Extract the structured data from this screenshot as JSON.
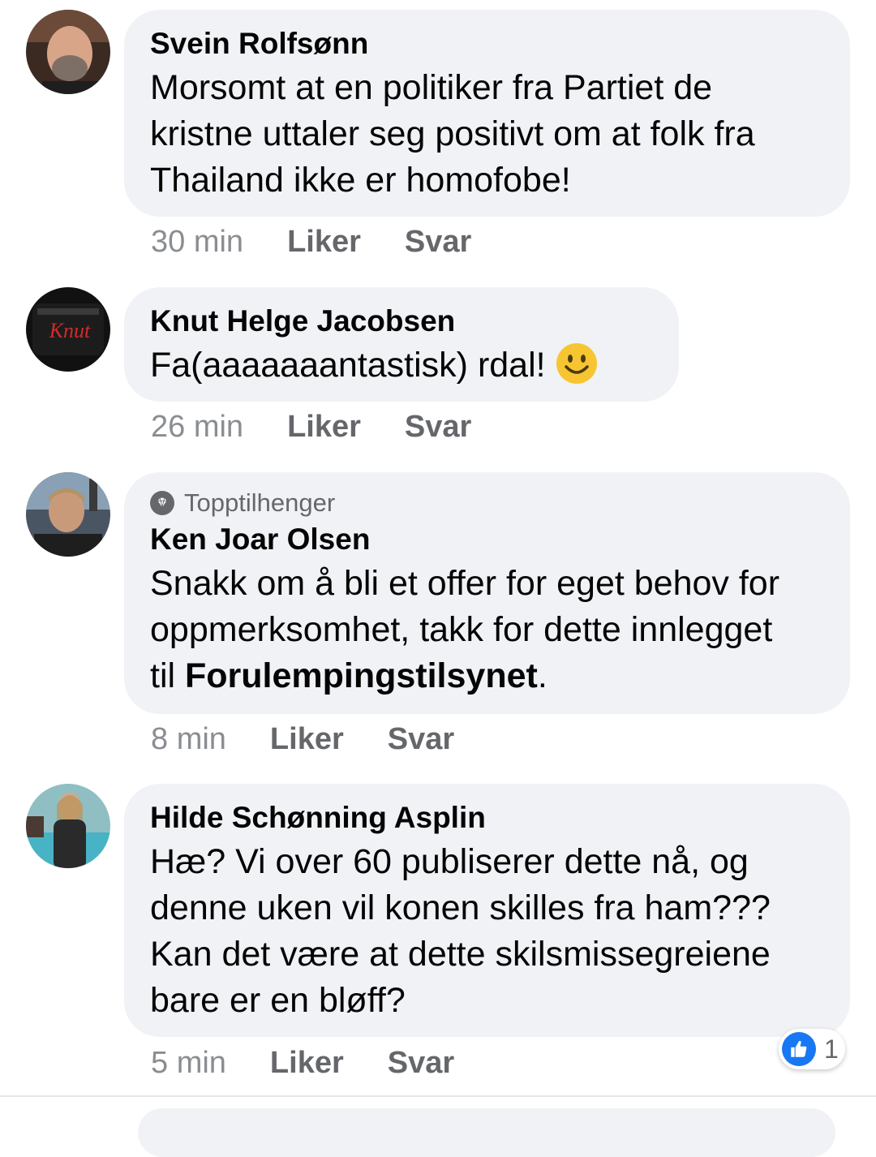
{
  "comments": [
    {
      "author": "Svein Rolfsønn",
      "lines": [
        "Morsomt at en politiker fra Partiet de",
        "kristne uttaler seg positivt om at folk fra",
        "Thailand ikke er homofobe!"
      ],
      "time": "30 min",
      "like_label": "Liker",
      "reply_label": "Svar"
    },
    {
      "author": "Knut Helge Jacobsen",
      "text": "Fa(aaaaaaantastisk) rdal!",
      "emoji": "smiley-emoji",
      "avatar_label": "Knut",
      "time": "26 min",
      "like_label": "Liker",
      "reply_label": "Svar"
    },
    {
      "badge": "Topptilhenger",
      "author": "Ken Joar Olsen",
      "lines": [
        "Snakk om å bli et offer for eget behov for",
        "oppmerksomhet, takk for dette innlegget"
      ],
      "line3_prefix": "til ",
      "line3_bold": "Forulempingstilsynet",
      "line3_suffix": ".",
      "time": "8 min",
      "like_label": "Liker",
      "reply_label": "Svar"
    },
    {
      "author": "Hilde Schønning Asplin",
      "lines": [
        "Hæ? Vi over 60 publiserer dette nå, og",
        "denne uken vil konen skilles fra ham???",
        "Kan det være at dette skilsmissegreiene",
        "bare er en bløff?"
      ],
      "time": "5 min",
      "like_label": "Liker",
      "reply_label": "Svar",
      "reaction_count": "1"
    }
  ],
  "colors": {
    "bubble": "#f0f2f5",
    "meta_time": "#8a8d91",
    "meta_action": "#65676b",
    "like_blue": "#1877f2"
  }
}
